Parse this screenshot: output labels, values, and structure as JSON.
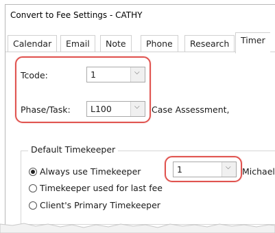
{
  "window": {
    "title": "Convert to Fee Settings - CATHY"
  },
  "tabs": [
    {
      "label": "Calendar"
    },
    {
      "label": "Email"
    },
    {
      "label": "Note"
    },
    {
      "label": "Phone"
    },
    {
      "label": "Research"
    },
    {
      "label": "Timer",
      "active": true
    }
  ],
  "form": {
    "tcode": {
      "label": "Tcode:",
      "value": "1"
    },
    "phase": {
      "label": "Phase/Task:",
      "value": "L100",
      "description": "Case Assessment,"
    }
  },
  "timekeeper": {
    "group_title": "Default Timekeeper",
    "options": [
      {
        "label": "Always use Timekeeper",
        "selected": true
      },
      {
        "label": "Timekeeper used for last fee",
        "selected": false
      },
      {
        "label": "Client's Primary Timekeeper",
        "selected": false
      }
    ],
    "combo_value": "1",
    "name_partial": "Michael"
  },
  "icons": {
    "dropdown": "chevron-down-icon"
  },
  "colors": {
    "highlight": "#e0534f",
    "border": "#a9a9a9"
  }
}
